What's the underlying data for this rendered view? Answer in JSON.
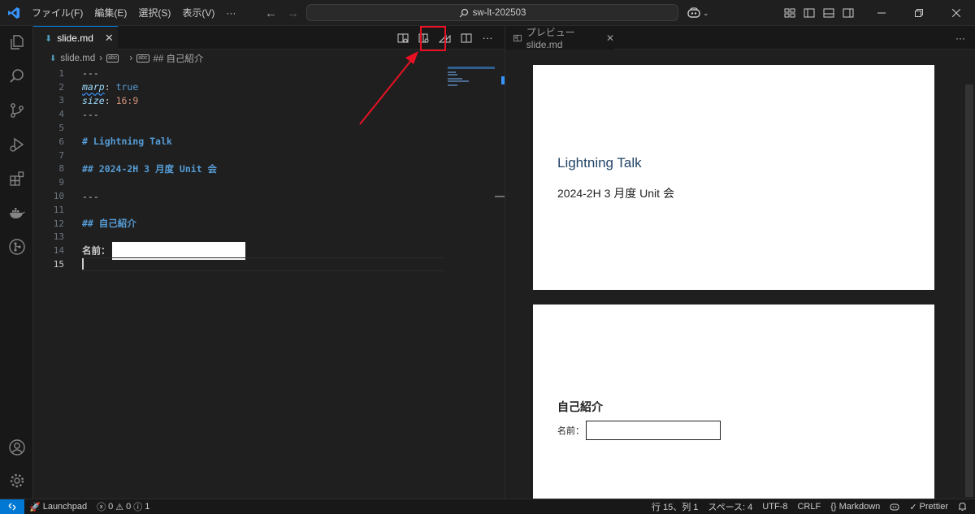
{
  "titlebar": {
    "menus": [
      "ファイル(F)",
      "編集(E)",
      "選択(S)",
      "表示(V)",
      "···"
    ],
    "search_text": "sw-lt-202503"
  },
  "editor": {
    "tab_title": "slide.md",
    "breadcrumb": {
      "file": "slide.md",
      "section": "## 自己紹介"
    },
    "lines": [
      {
        "num": "1"
      },
      {
        "num": "2"
      },
      {
        "num": "3"
      },
      {
        "num": "4"
      },
      {
        "num": "5"
      },
      {
        "num": "6"
      },
      {
        "num": "7"
      },
      {
        "num": "8"
      },
      {
        "num": "9"
      },
      {
        "num": "10"
      },
      {
        "num": "11"
      },
      {
        "num": "12"
      },
      {
        "num": "13"
      },
      {
        "num": "14"
      },
      {
        "num": "15"
      }
    ],
    "code": {
      "l1": "---",
      "l2_key": "marp",
      "l2_val": "true",
      "l3_key": "size",
      "l3_val": "16:9",
      "l4": "---",
      "l6": "# Lightning Talk",
      "l8": "## 2024-2H 3 月度 Unit 会",
      "l10": "---",
      "l12": "## 自己紹介",
      "l14": "名前："
    }
  },
  "preview": {
    "tab_title": "プレビュー slide.md",
    "slide1_title": "Lightning Talk",
    "slide1_sub": "2024-2H 3 月度 Unit 会",
    "slide2_title": "自己紹介",
    "slide2_name_label": "名前："
  },
  "statusbar": {
    "launchpad": "Launchpad",
    "errors": "0",
    "warnings": "0",
    "info": "1",
    "position": "行 15、列 1",
    "spaces": "スペース: 4",
    "encoding": "UTF-8",
    "eol": "CRLF",
    "language": "Markdown",
    "prettier": "Prettier"
  },
  "colors": {
    "accent": "#0078d4",
    "highlight": "#e81123"
  }
}
